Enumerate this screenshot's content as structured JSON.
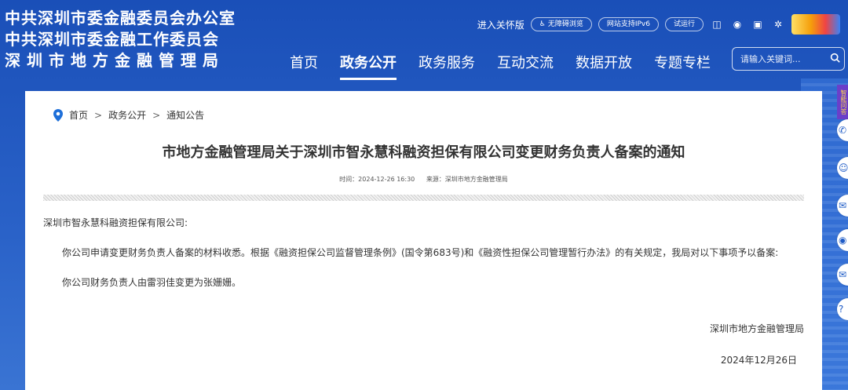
{
  "header": {
    "org_line1": "中共深圳市委金融委员会办公室",
    "org_line2": "中共深圳市委金融工作委员会",
    "org_line3": "深圳市地方金融管理局",
    "care_mode": "进入关怀版",
    "accessibility": "无障碍浏览",
    "ipv6": "网站支持IPv6",
    "trial": "试运行",
    "nav": [
      {
        "label": "首页"
      },
      {
        "label": "政务公开",
        "active": true
      },
      {
        "label": "政务服务"
      },
      {
        "label": "互动交流"
      },
      {
        "label": "数据开放"
      },
      {
        "label": "专题专栏"
      }
    ],
    "search_placeholder": "请输入关键词...",
    "search_icon": "search-icon"
  },
  "breadcrumb": {
    "items": [
      "首页",
      "政务公开",
      "通知公告"
    ],
    "separator": ">"
  },
  "article": {
    "title": "市地方金融管理局关于深圳市智永慧科融资担保有限公司变更财务负责人备案的通知",
    "time": "时间：2024-12-26 16:30",
    "source": "来源：深圳市地方金融管理局",
    "salutation": "深圳市智永慧科融资担保有限公司:",
    "para1": "你公司申请变更财务负责人备案的材料收悉。根据《融资担保公司监督管理条例》(国令第683号)和《融资性担保公司管理暂行办法》的有关规定，我局对以下事项予以备案:",
    "para2": "你公司财务负责人由雷羽佳变更为张姗姗。",
    "signature": "深圳市地方金融管理局",
    "date": "2024年12月26日"
  },
  "side": {
    "tab": "智能问答"
  },
  "colors": {
    "header_bg": "#1a4fb8",
    "panel_bg": "#ffffff",
    "text": "#333333",
    "accent_pin": "#1e6fd9"
  }
}
